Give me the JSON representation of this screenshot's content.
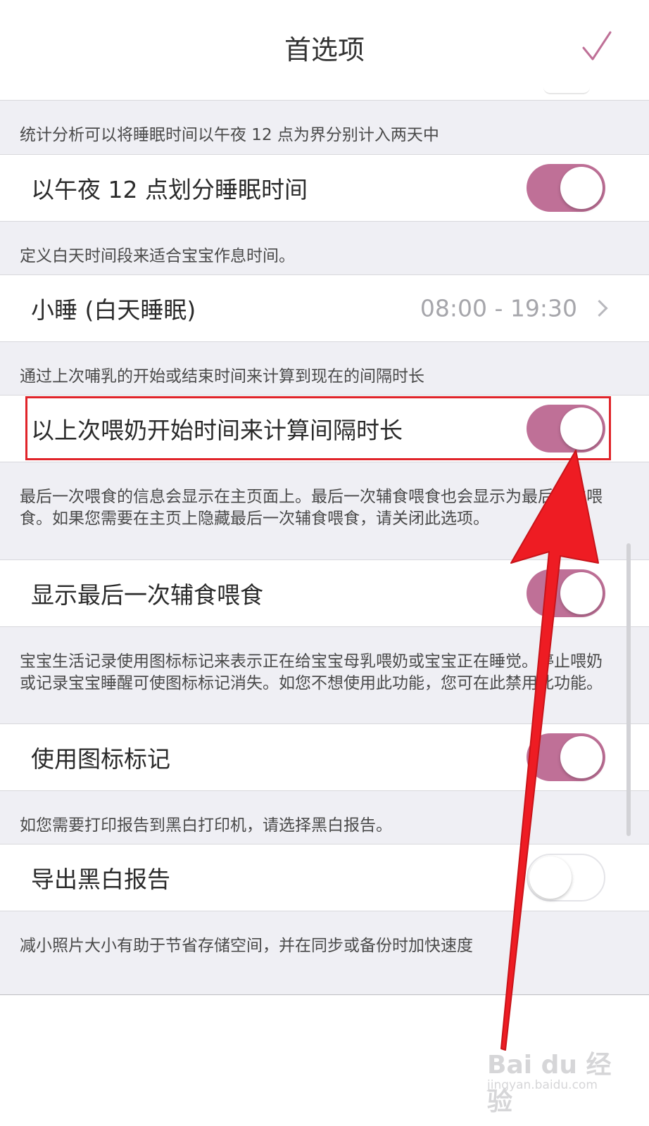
{
  "nav": {
    "title": "首选项",
    "done_icon": "checkmark-icon"
  },
  "sections": [
    {
      "footer": "统计分析可以将睡眠时间以午夜 12 点为界分别计入两天中",
      "row": {
        "label": "以午夜 12 点划分睡眠时间",
        "toggle": true
      }
    },
    {
      "footer": "定义白天时间段来适合宝宝作息时间。",
      "row": {
        "label": "小睡 (白天睡眠)",
        "value": "08:00 - 19:30"
      }
    },
    {
      "footer": "通过上次哺乳的开始或结束时间来计算到现在的间隔时长",
      "row": {
        "label": "以上次喂奶开始时间来计算间隔时长",
        "toggle": true
      }
    },
    {
      "footer": "最后一次喂食的信息会显示在主页面上。最后一次辅食喂食也会显示为最后一次喂食。如果您需要在主页上隐藏最后一次辅食喂食，请关闭此选项。",
      "row": {
        "label": "显示最后一次辅食喂食",
        "toggle": true
      }
    },
    {
      "footer": "宝宝生活记录使用图标标记来表示正在给宝宝母乳喂奶或宝宝正在睡觉。停止喂奶或记录宝宝睡醒可使图标标记消失。如您不想使用此功能，您可在此禁用此功能。",
      "row": {
        "label": "使用图标标记",
        "toggle": true
      }
    },
    {
      "footer": "如您需要打印报告到黑白打印机，请选择黑白报告。",
      "row": {
        "label": "导出黑白报告",
        "toggle": false
      }
    },
    {
      "footer": "减小照片大小有助于节省存储空间，并在同步或备份时加快速度"
    }
  ],
  "colors": {
    "accent": "#bf7097",
    "annotation_red": "#e0242a"
  },
  "watermark": {
    "logo": "Bai du 经验",
    "url": "jingyan.baidu.com"
  }
}
